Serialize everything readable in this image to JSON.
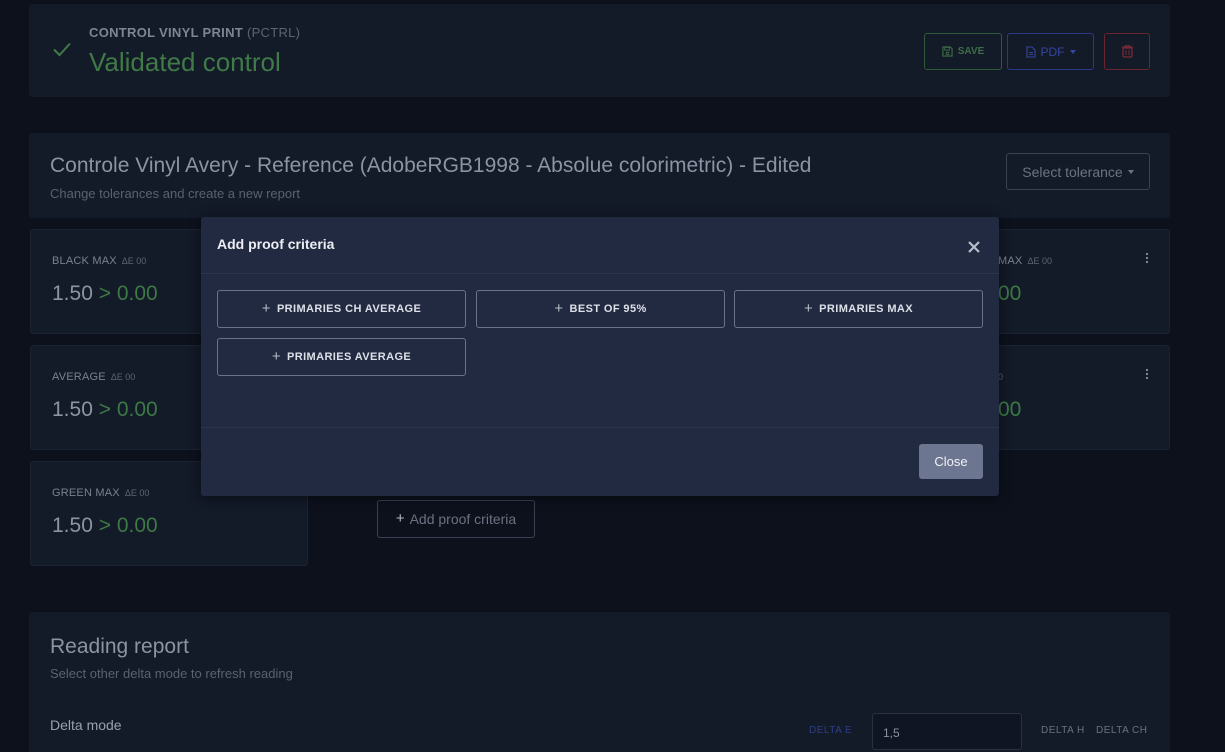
{
  "header": {
    "subtitle": "CONTROL VINYL PRINT",
    "code": "(PCTRL)",
    "status_title": "Validated control",
    "save_label": "SAVE",
    "pdf_label": "PDF"
  },
  "reference": {
    "title": "Controle Vinyl Avery - Reference (AdobeRGB1998 - Absolue colorimetric) - Edited",
    "description": "Change tolerances and create a new report",
    "tolerance_label": "Select tolerance"
  },
  "criteria": [
    {
      "label": "BLACK MAX",
      "unit": "ΔE 00",
      "tolerance": "1.50",
      "current": "> 0.00"
    },
    {
      "label": "AVERAGE",
      "unit": "ΔE 00",
      "tolerance": "1.50",
      "current": "> 0.00"
    },
    {
      "label": "GREEN MAX",
      "unit": "ΔE 00",
      "tolerance": "1.50",
      "current": "> 0.00"
    }
  ],
  "right_cards": [
    {
      "label_fragment": "MAX",
      "unit": "ΔE 00",
      "value_fragment": "00"
    },
    {
      "label_fragment": "0",
      "value_fragment": "00"
    }
  ],
  "add_criteria_label": "Add proof criteria",
  "reading_report": {
    "title": "Reading report",
    "description": "Select other delta mode to refresh reading",
    "delta_mode_label": "Delta mode",
    "delta_e": "DELTA E",
    "delta_e_value": "1,5",
    "delta_h": "DELTA H",
    "delta_ch": "DELTA CH"
  },
  "modal": {
    "title": "Add proof criteria",
    "options": [
      "PRIMARIES CH AVERAGE",
      "BEST OF 95%",
      "PRIMARIES MAX",
      "PRIMARIES AVERAGE"
    ],
    "close_label": "Close"
  },
  "colors": {
    "success": "#3f7a47",
    "danger": "#7f2a35",
    "primary": "#3646a0",
    "modal_bg": "#222a42"
  }
}
